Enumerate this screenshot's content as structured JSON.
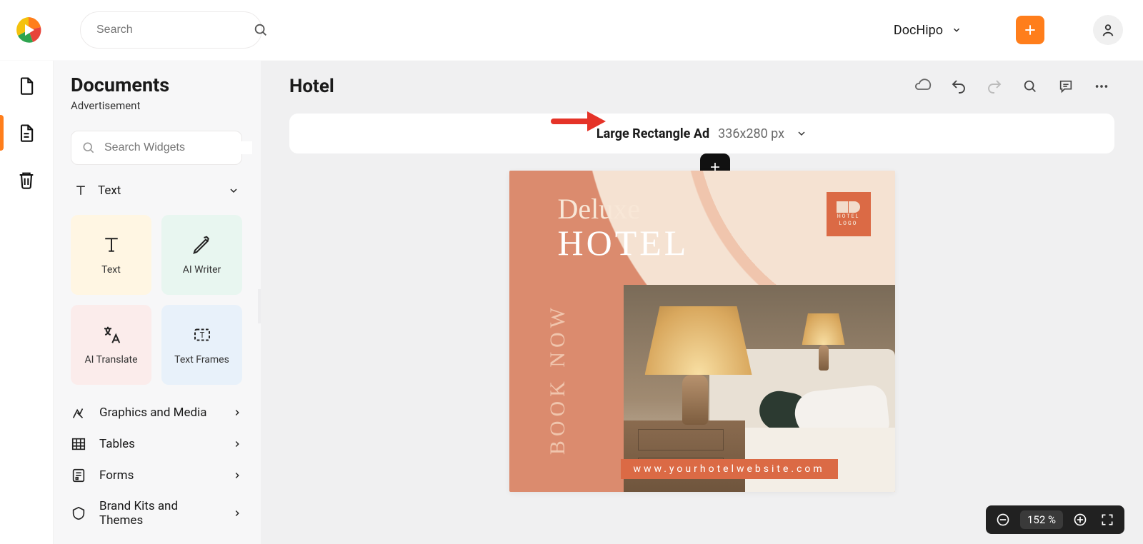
{
  "topbar": {
    "search_placeholder": "Search",
    "team_label": "DocHipo"
  },
  "rail": {
    "items": [
      "new-doc",
      "documents",
      "trash"
    ]
  },
  "sidebar": {
    "title": "Documents",
    "subtitle": "Advertisement",
    "widget_search_placeholder": "Search Widgets",
    "text_section": "Text",
    "cards": {
      "text": "Text",
      "ai_writer": "AI Writer",
      "ai_translate": "AI Translate",
      "text_frames": "Text Frames"
    },
    "rows": [
      {
        "key": "graphics",
        "label": "Graphics and Media"
      },
      {
        "key": "tables",
        "label": "Tables"
      },
      {
        "key": "forms",
        "label": "Forms"
      },
      {
        "key": "brand",
        "label": "Brand Kits and Themes"
      }
    ]
  },
  "main": {
    "title": "Hotel",
    "format_name": "Large Rectangle Ad",
    "format_size": "336x280 px"
  },
  "canvas": {
    "logo_l1": "HOTEL",
    "logo_l2": "LOGO",
    "deluxe": "Deluxe",
    "hotel": "HOTEL",
    "book": "BOOK NOW",
    "url": "www.yourhotelwebsite.com"
  },
  "zoom": {
    "value": "152 %"
  }
}
